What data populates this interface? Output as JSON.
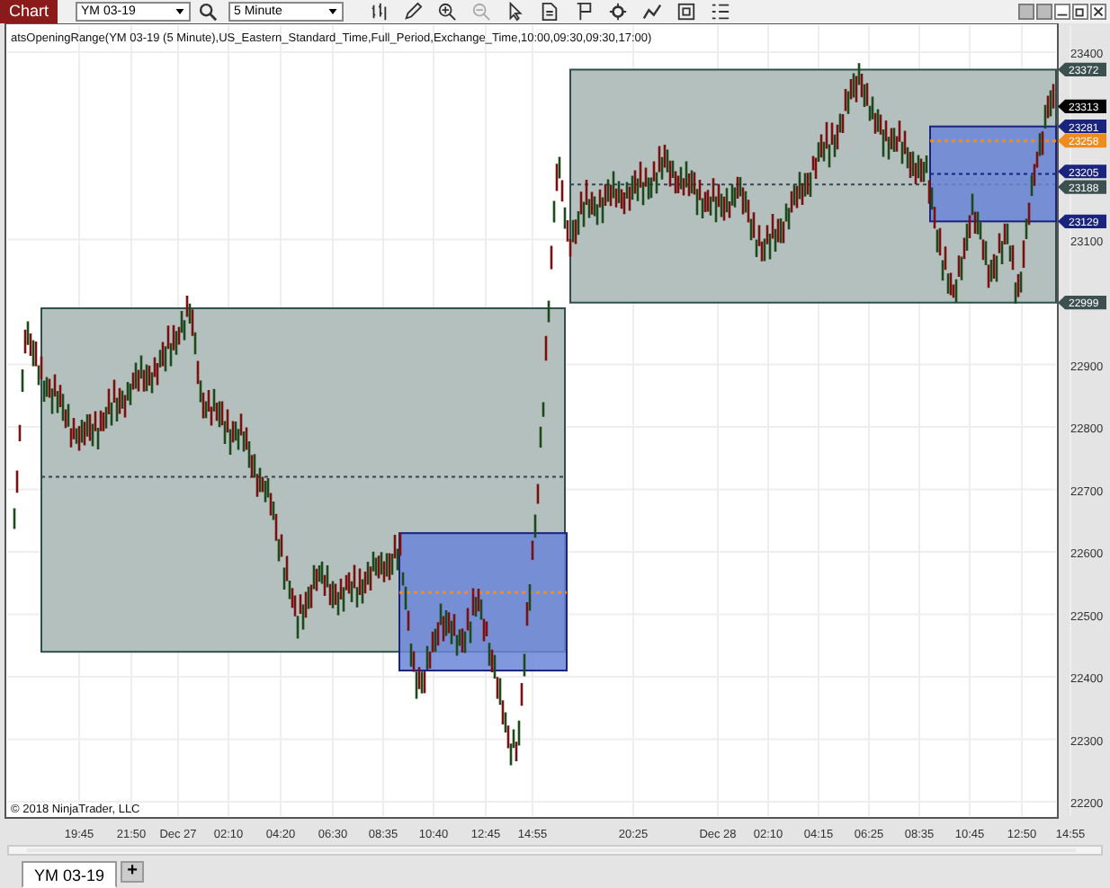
{
  "toolbar": {
    "app_label": "Chart",
    "instrument": "YM 03-19",
    "interval": "5 Minute"
  },
  "indicator_label": "atsOpeningRange(YM 03-19 (5 Minute),US_Eastern_Standard_Time,Full_Period,Exchange_Time,10:00,09:30,09:30,17:00)",
  "y_ticks": [
    "23400",
    "23100",
    "22900",
    "22800",
    "22700",
    "22600",
    "22500",
    "22400",
    "22300",
    "22200"
  ],
  "price_tags": [
    {
      "label": "23372",
      "color": "#3c5050"
    },
    {
      "label": "23313",
      "color": "#000000"
    },
    {
      "label": "23281",
      "color": "#1a237e"
    },
    {
      "label": "23258",
      "color": "#f08c1e"
    },
    {
      "label": "23205",
      "color": "#1a237e"
    },
    {
      "label": "23188",
      "color": "#3c5050"
    },
    {
      "label": "23129",
      "color": "#1a237e"
    },
    {
      "label": "22999",
      "color": "#3c5050"
    }
  ],
  "x_ticks": [
    "19:45",
    "21:50",
    "Dec 27",
    "02:10",
    "04:20",
    "06:30",
    "08:35",
    "10:40",
    "12:45",
    "14:55",
    "20:25",
    "Dec 28",
    "02:10",
    "04:15",
    "06:25",
    "08:35",
    "10:45",
    "12:50",
    "14:55"
  ],
  "copyright": "© 2018 NinjaTrader, LLC",
  "tabs": [
    {
      "label": "YM 03-19",
      "selected": true
    }
  ],
  "add_tab": "+"
}
